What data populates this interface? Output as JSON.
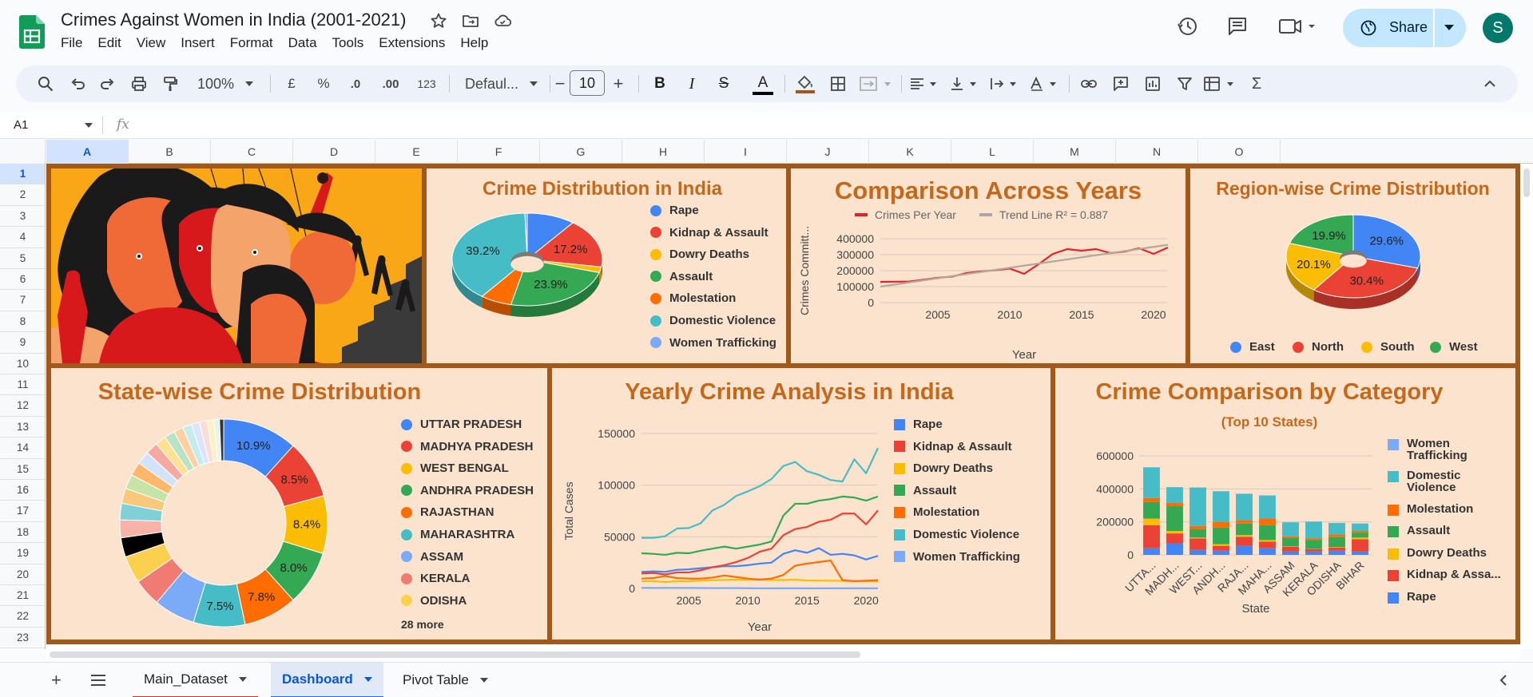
{
  "app": {
    "doc_title": "Crimes Against Women in India (2001-2021)",
    "menu": [
      "File",
      "Edit",
      "View",
      "Insert",
      "Format",
      "Data",
      "Tools",
      "Extensions",
      "Help"
    ],
    "share_label": "Share",
    "avatar_initial": "S",
    "icons": [
      "sheets-logo-icon",
      "star-icon",
      "move-folder-icon",
      "cloud-status-icon",
      "history-icon",
      "comment-icon",
      "meet-video-icon"
    ]
  },
  "toolbar": {
    "zoom": "100%",
    "currency": "£",
    "percent": "%",
    "decrease_decimal": ".0",
    "increase_decimal": ".00",
    "number_format": "123",
    "font": "Defaul...",
    "font_size": "10",
    "minus": "−",
    "plus": "+",
    "bold": "B",
    "italic": "I",
    "strike": "S",
    "text_color": "A",
    "sigma": "Σ"
  },
  "formula_bar": {
    "cell_ref": "A1",
    "fx": "fx"
  },
  "grid": {
    "columns": [
      "A",
      "B",
      "C",
      "D",
      "E",
      "F",
      "G",
      "H",
      "I",
      "J",
      "K",
      "L",
      "M",
      "N",
      "O"
    ],
    "rows": [
      "1",
      "2",
      "3",
      "4",
      "5",
      "6",
      "7",
      "8",
      "9",
      "10",
      "11",
      "12",
      "13",
      "14",
      "15",
      "16",
      "17",
      "18",
      "19",
      "20",
      "21",
      "22",
      "23",
      "24"
    ]
  },
  "sheets": {
    "add": "+",
    "tabs": [
      "Main_Dataset",
      "Dashboard",
      "Pivot Table"
    ],
    "active": "Dashboard"
  },
  "colors": {
    "dashboard_border": "#a0591a",
    "panel_bg": "#fbe3cd",
    "title_orange": "#c6681b",
    "share_bg": "#c2e7ff",
    "rape": "#4285f4",
    "kidnap": "#ea4335",
    "dowry": "#fbbc04",
    "assault": "#34a853",
    "molestation": "#ff6d01",
    "domestic": "#46bdc6",
    "trafficking": "#7baaf7"
  },
  "panels": {
    "crime_distribution": {
      "title": "Crime Distribution in India",
      "legend": [
        "Rape",
        "Kidnap & Assault",
        "Dowry Deaths",
        "Assault",
        "Molestation",
        "Domestic Violence",
        "Women Trafficking"
      ]
    },
    "comparison": {
      "title": "Comparison Across Years",
      "legend": [
        "Crimes Per Year",
        "Trend Line  R² = 0.887"
      ],
      "ylabel": "Crimes Committ...",
      "xlabel": "Year"
    },
    "region": {
      "title": "Region-wise Crime Distribution",
      "legend": [
        "East",
        "North",
        "South",
        "West"
      ]
    },
    "state": {
      "title": "State-wise Crime Distribution",
      "legend": [
        "UTTAR PRADESH",
        "MADHYA PRADESH",
        "WEST BENGAL",
        "ANDHRA PRADESH",
        "RAJASTHAN",
        "MAHARASHTRA",
        "ASSAM",
        "KERALA",
        "ODISHA"
      ],
      "more": "28 more"
    },
    "yearly": {
      "title": "Yearly Crime Analysis in India",
      "legend": [
        "Rape",
        "Kidnap & Assault",
        "Dowry Deaths",
        "Assault",
        "Molestation",
        "Domestic Violence",
        "Women Trafficking"
      ],
      "ylabel": "Total Cases",
      "xlabel": "Year"
    },
    "category": {
      "title": "Crime Comparison by Category",
      "subtitle": "(Top 10 States)",
      "legend": [
        "Women Trafficking",
        "Domestic Violence",
        "Molestation",
        "Assault",
        "Dowry Deaths",
        "Kidnap & Assa...",
        "Rape"
      ],
      "xlabel": "State"
    }
  },
  "chart_data": [
    {
      "type": "pie",
      "title": "Crime Distribution in India",
      "categories": [
        "Rape",
        "Kidnap & Assault",
        "Dowry Deaths",
        "Assault",
        "Molestation",
        "Domestic Violence",
        "Women Trafficking"
      ],
      "values": [
        10.4,
        17.2,
        2.0,
        23.9,
        6.8,
        39.2,
        0.5
      ],
      "labels": [
        "",
        "17.2%",
        "",
        "23.9%",
        "",
        "39.2%",
        ""
      ]
    },
    {
      "type": "line",
      "title": "Comparison Across Years",
      "x": [
        2001,
        2002,
        2003,
        2004,
        2005,
        2006,
        2007,
        2008,
        2009,
        2010,
        2011,
        2012,
        2013,
        2014,
        2015,
        2016,
        2017,
        2018,
        2019,
        2020,
        2021
      ],
      "series": [
        {
          "name": "Crimes Per Year",
          "values": [
            130000,
            131000,
            132000,
            143000,
            155000,
            163000,
            185000,
            195000,
            203000,
            213000,
            180000,
            240000,
            305000,
            335000,
            325000,
            335000,
            310000,
            320000,
            340000,
            305000,
            345000
          ]
        },
        {
          "name": "Trend Line",
          "values": [
            100000,
            362000
          ]
        }
      ],
      "xlabel": "Year",
      "ylabel": "Crimes Committ...",
      "ylim": [
        0,
        400000
      ],
      "yticks": [
        0,
        100000,
        200000,
        300000,
        400000
      ],
      "xticks": [
        2005,
        2010,
        2015,
        2020
      ]
    },
    {
      "type": "pie",
      "title": "Region-wise Crime Distribution",
      "categories": [
        "East",
        "North",
        "South",
        "West"
      ],
      "values": [
        29.6,
        30.4,
        20.1,
        19.9
      ],
      "labels": [
        "29.6%",
        "30.4%",
        "20.1%",
        "19.9%"
      ]
    },
    {
      "type": "pie",
      "title": "State-wise Crime Distribution",
      "categories": [
        "UTTAR PRADESH",
        "MADHYA PRADESH",
        "WEST BENGAL",
        "ANDHRA PRADESH",
        "RAJASTHAN",
        "MAHARASHTRA",
        "ASSAM",
        "KERALA",
        "ODISHA"
      ],
      "values": [
        10.9,
        8.5,
        8.4,
        8.0,
        7.8,
        7.5,
        6.0,
        4.0,
        4.0
      ],
      "labels": [
        "10.9%",
        "8.5%",
        "8.4%",
        "8.0%",
        "7.8%",
        "7.5%",
        "",
        "",
        ""
      ],
      "more": "28 more"
    },
    {
      "type": "line",
      "title": "Yearly Crime Analysis in India",
      "x": [
        2001,
        2002,
        2003,
        2004,
        2005,
        2006,
        2007,
        2008,
        2009,
        2010,
        2011,
        2012,
        2013,
        2014,
        2015,
        2016,
        2017,
        2018,
        2019,
        2020,
        2021
      ],
      "series": [
        {
          "name": "Rape",
          "values": [
            16000,
            16500,
            16000,
            18000,
            18500,
            19500,
            20500,
            21500,
            21500,
            22500,
            24000,
            25000,
            33500,
            37000,
            34500,
            39000,
            32500,
            33500,
            32000,
            28000,
            31500
          ]
        },
        {
          "name": "Kidnap & Assault",
          "values": [
            14500,
            15000,
            13500,
            15500,
            15500,
            17500,
            20500,
            22500,
            25500,
            29500,
            35500,
            38500,
            51500,
            57500,
            59500,
            64500,
            66500,
            72500,
            72500,
            62000,
            75500
          ]
        },
        {
          "name": "Dowry Deaths",
          "values": [
            7000,
            7000,
            6200,
            7000,
            6800,
            7600,
            8000,
            8200,
            8400,
            8400,
            8600,
            8200,
            8100,
            8500,
            7600,
            7600,
            7500,
            7300,
            7100,
            7000,
            6800
          ]
        },
        {
          "name": "Assault",
          "values": [
            34000,
            33500,
            32500,
            34500,
            34000,
            36500,
            38500,
            40500,
            38500,
            40500,
            42500,
            45500,
            70500,
            82000,
            82000,
            85000,
            86500,
            89000,
            88000,
            85000,
            89000
          ]
        },
        {
          "name": "Molestation",
          "values": [
            9500,
            10000,
            12000,
            10000,
            9500,
            9500,
            10500,
            12500,
            11000,
            9500,
            8500,
            9500,
            13000,
            22000,
            24000,
            25500,
            27000,
            8000,
            7000,
            7500,
            8000
          ]
        },
        {
          "name": "Domestic Violence",
          "values": [
            49000,
            49000,
            50500,
            58000,
            58500,
            63000,
            75500,
            81000,
            89500,
            94000,
            99000,
            106000,
            118500,
            122500,
            113500,
            110000,
            105000,
            103500,
            125000,
            111500,
            136000
          ]
        },
        {
          "name": "Women Trafficking",
          "values": [
            500,
            500,
            500,
            500,
            500,
            400,
            300,
            300,
            300,
            200,
            100,
            100,
            100,
            100,
            100,
            100,
            100,
            100,
            100,
            100,
            100
          ]
        }
      ],
      "xlabel": "Year",
      "ylabel": "Total Cases",
      "ylim": [
        0,
        150000
      ],
      "yticks": [
        0,
        50000,
        100000,
        150000
      ],
      "xticks": [
        2005,
        2010,
        2015,
        2020
      ]
    },
    {
      "type": "bar",
      "stacked": true,
      "title": "Crime Comparison by Category",
      "subtitle": "(Top 10 States)",
      "categories": [
        "UTTA...",
        "MADH...",
        "WEST...",
        "ANDH...",
        "RAJA...",
        "MAHA...",
        "ASSAM",
        "KERALA",
        "ODISHA",
        "BIHAR"
      ],
      "series": [
        {
          "name": "Rape",
          "values": [
            40000,
            70000,
            30000,
            25000,
            55000,
            40000,
            20000,
            20000,
            25000,
            20000
          ]
        },
        {
          "name": "Kidnap & Assa...",
          "values": [
            140000,
            60000,
            70000,
            30000,
            55000,
            40000,
            30000,
            15000,
            20000,
            75000
          ]
        },
        {
          "name": "Dowry Deaths",
          "values": [
            40000,
            15000,
            5000,
            10000,
            10000,
            10000,
            2000,
            1000,
            3000,
            10000
          ]
        },
        {
          "name": "Assault",
          "values": [
            100000,
            150000,
            50000,
            100000,
            70000,
            90000,
            50000,
            55000,
            60000,
            30000
          ]
        },
        {
          "name": "Molestation",
          "values": [
            25000,
            20000,
            20000,
            35000,
            20000,
            40000,
            10000,
            10000,
            15000,
            10000
          ]
        },
        {
          "name": "Domestic Violence",
          "values": [
            185000,
            95000,
            233000,
            185000,
            160000,
            140000,
            85000,
            100000,
            70000,
            45000
          ]
        },
        {
          "name": "Women Trafficking",
          "values": [
            1000,
            1000,
            1000,
            1000,
            1000,
            1000,
            1000,
            1000,
            1000,
            1000
          ]
        }
      ],
      "xlabel": "State",
      "ylim": [
        0,
        600000
      ],
      "yticks": [
        0,
        200000,
        400000,
        600000
      ]
    }
  ]
}
